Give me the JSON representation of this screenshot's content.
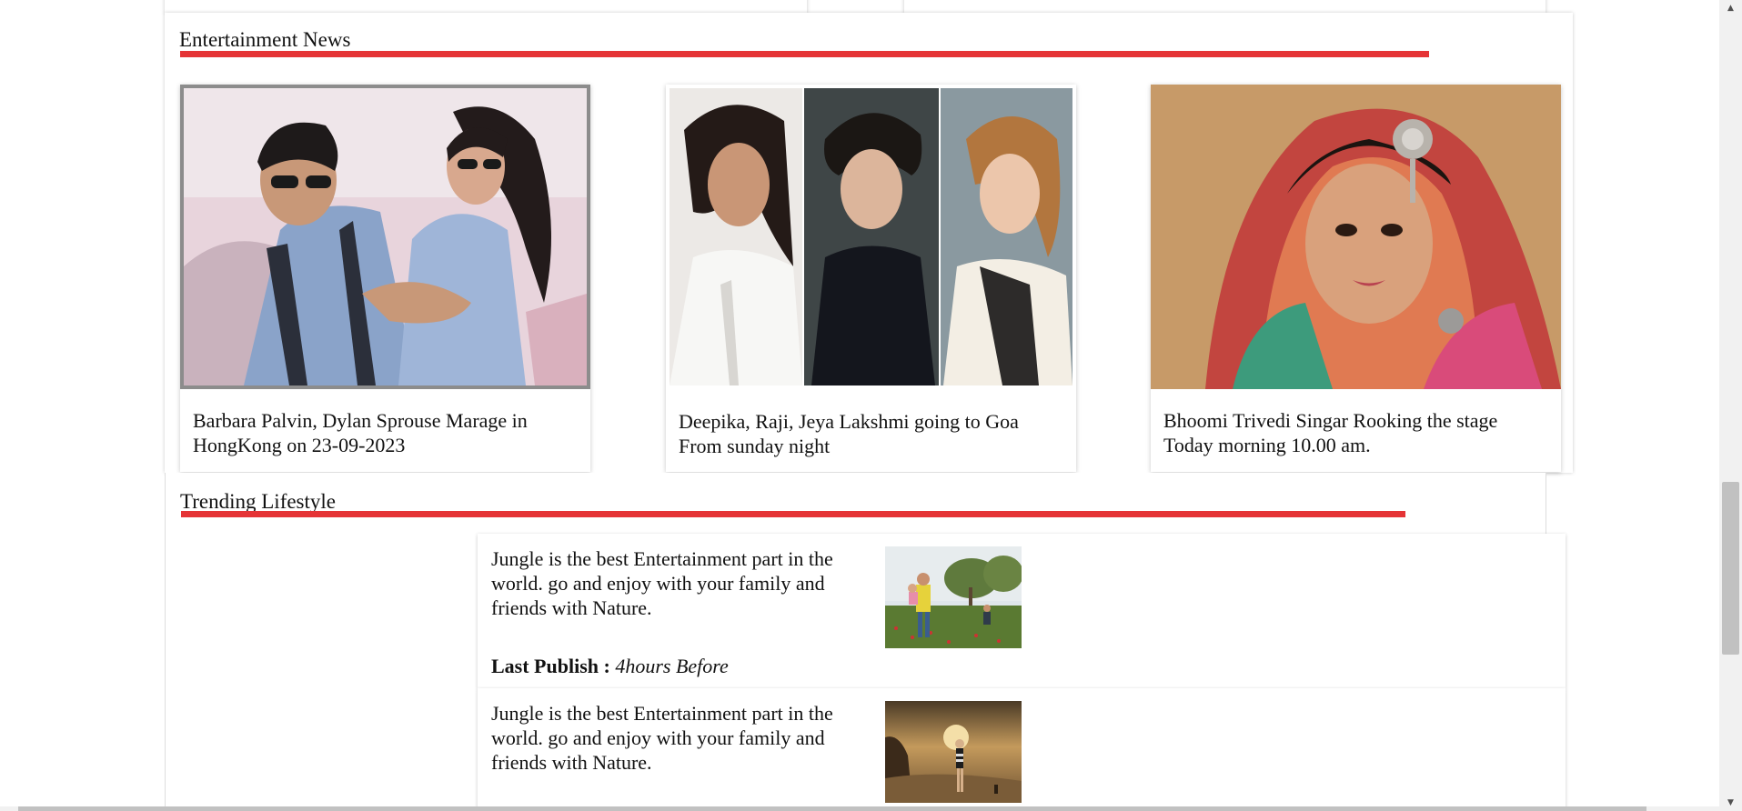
{
  "entertainment": {
    "title": "Entertainment News",
    "cards": [
      {
        "caption": "Barbara Palvin, Dylan Sprouse Marage in HongKong on 23-09-2023",
        "image": "couple-photo"
      },
      {
        "caption": "Deepika, Raji, Jeya Lakshmi going to Goa From sunday night",
        "image": "three-portraits-photo"
      },
      {
        "caption": "Bhoomi Trivedi Singar Rooking the stage Today morning 10.00 am.",
        "image": "bridal-portrait-photo"
      }
    ]
  },
  "trending": {
    "title": "Trending Lifestyle",
    "items": [
      {
        "text": "Jungle is the best Entertainment part in the world. go and enjoy with your family and friends with Nature.",
        "publish_label": "Last Publish :",
        "publish_value": "4hours Before",
        "image": "family-field-photo"
      },
      {
        "text": "Jungle is the best Entertainment part in the world. go and enjoy with your family and friends with Nature.",
        "image": "desert-sunset-photo"
      }
    ]
  },
  "colors": {
    "accent": "#e53436",
    "text": "#111111",
    "background": "#ffffff"
  },
  "icons": {
    "scroll_up": "triangle-up-icon",
    "scroll_down": "triangle-down-icon"
  }
}
